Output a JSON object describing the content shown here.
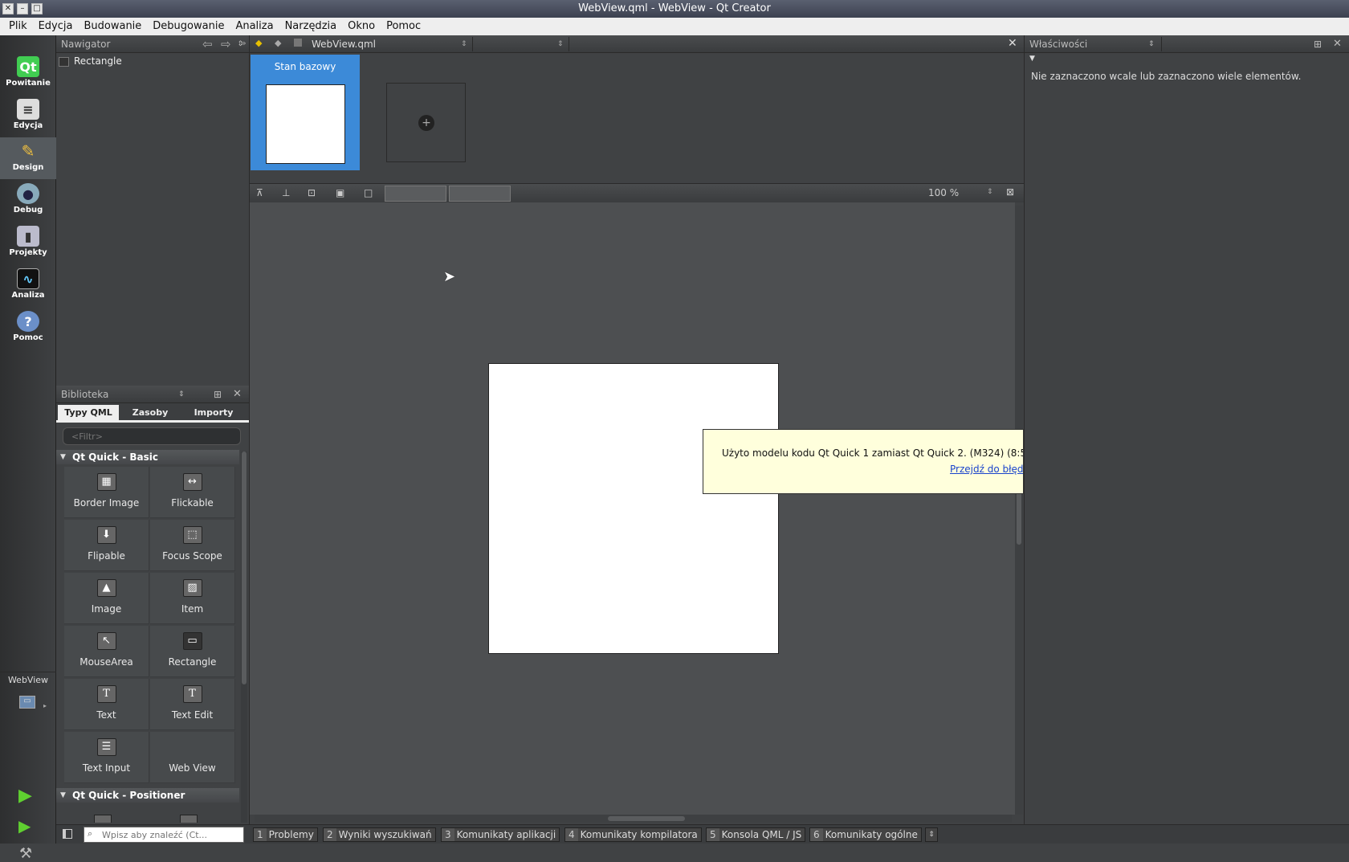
{
  "window": {
    "title": "WebView.qml - WebView - Qt Creator"
  },
  "menu": [
    "Plik",
    "Edycja",
    "Budowanie",
    "Debugowanie",
    "Analiza",
    "Narzędzia",
    "Okno",
    "Pomoc"
  ],
  "modes": [
    {
      "label": "Powitanie",
      "icon": "qt-logo-icon"
    },
    {
      "label": "Edycja",
      "icon": "edit-document-icon"
    },
    {
      "label": "Design",
      "icon": "design-brush-icon"
    },
    {
      "label": "Debug",
      "icon": "debug-bug-icon"
    },
    {
      "label": "Projekty",
      "icon": "projects-icon"
    },
    {
      "label": "Analiza",
      "icon": "analyze-chart-icon"
    },
    {
      "label": "Pomoc",
      "icon": "help-icon"
    }
  ],
  "project_target": {
    "label": "WebView"
  },
  "navigator": {
    "title": "Nawigator",
    "items": [
      "Rectangle"
    ]
  },
  "editor": {
    "file": "WebView.qml",
    "zoom": "100 %"
  },
  "states": {
    "base_state": "Stan bazowy"
  },
  "library": {
    "title": "Biblioteka",
    "tabs": [
      "Typy QML",
      "Zasoby",
      "Importy"
    ],
    "filter_placeholder": "<Filtr>",
    "categories": [
      "Qt Quick - Basic",
      "Qt Quick - Positioner"
    ],
    "items": [
      {
        "label": "Border Image",
        "glyph": "▦"
      },
      {
        "label": "Flickable",
        "glyph": "↔"
      },
      {
        "label": "Flipable",
        "glyph": "⬇"
      },
      {
        "label": "Focus Scope",
        "glyph": "⬚"
      },
      {
        "label": "Image",
        "glyph": "▲"
      },
      {
        "label": "Item",
        "glyph": "▨"
      },
      {
        "label": "MouseArea",
        "glyph": "↖"
      },
      {
        "label": "Rectangle",
        "glyph": "▭"
      },
      {
        "label": "Text",
        "glyph": "T"
      },
      {
        "label": "Text Edit",
        "glyph": "T"
      },
      {
        "label": "Text Input",
        "glyph": "☰"
      },
      {
        "label": "Web View",
        "glyph": ""
      }
    ]
  },
  "properties": {
    "title": "Właściwości",
    "message": "Nie zaznaczono wcale lub zaznaczono wiele elementów."
  },
  "tooltip": {
    "message": "Użyto modelu kodu Qt Quick 1 zamiast Qt Quick 2. (M324) (8:5",
    "link": "Przejdź do błędu"
  },
  "statusbar": {
    "locator_placeholder": "Wpisz aby znaleźć (Ct...",
    "tabs": [
      {
        "num": "1",
        "label": "Problemy"
      },
      {
        "num": "2",
        "label": "Wyniki wyszukiwań"
      },
      {
        "num": "3",
        "label": "Komunikaty aplikacji"
      },
      {
        "num": "4",
        "label": "Komunikaty kompilatora"
      },
      {
        "num": "5",
        "label": "Konsola QML / JS"
      },
      {
        "num": "6",
        "label": "Komunikaty ogólne"
      }
    ]
  }
}
